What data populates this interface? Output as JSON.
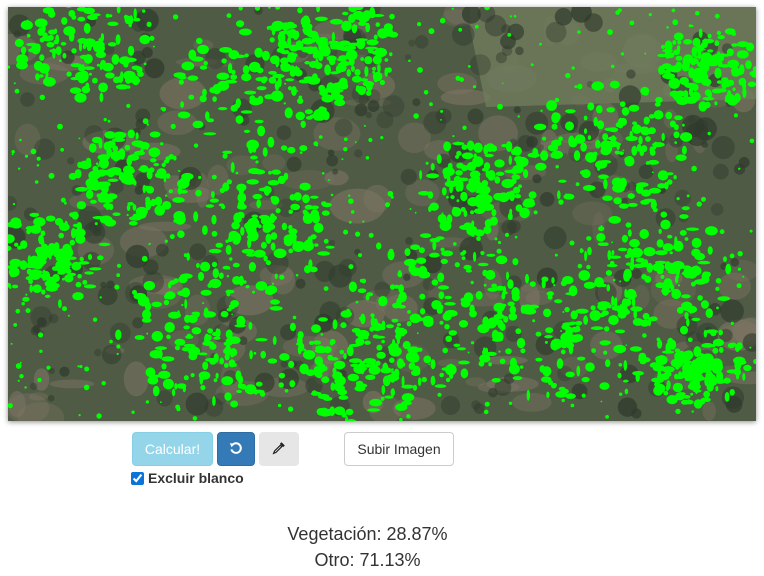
{
  "image": {
    "colors": {
      "ground": "#4f5b45",
      "soil": "#7f7565",
      "field": "#6e7a5c",
      "highlight": "#00ff00"
    }
  },
  "toolbar": {
    "calculate_label": "Calcular!",
    "reset_icon": "undo-icon",
    "picker_icon": "eyedropper-icon",
    "upload_label": "Subir Imagen",
    "exclude_white_label": "Excluir blanco",
    "exclude_white_checked": true
  },
  "results": {
    "vegetation_label": "Vegetación:",
    "vegetation_value": "28.87%",
    "other_label": "Otro:",
    "other_value": "71.13%"
  }
}
